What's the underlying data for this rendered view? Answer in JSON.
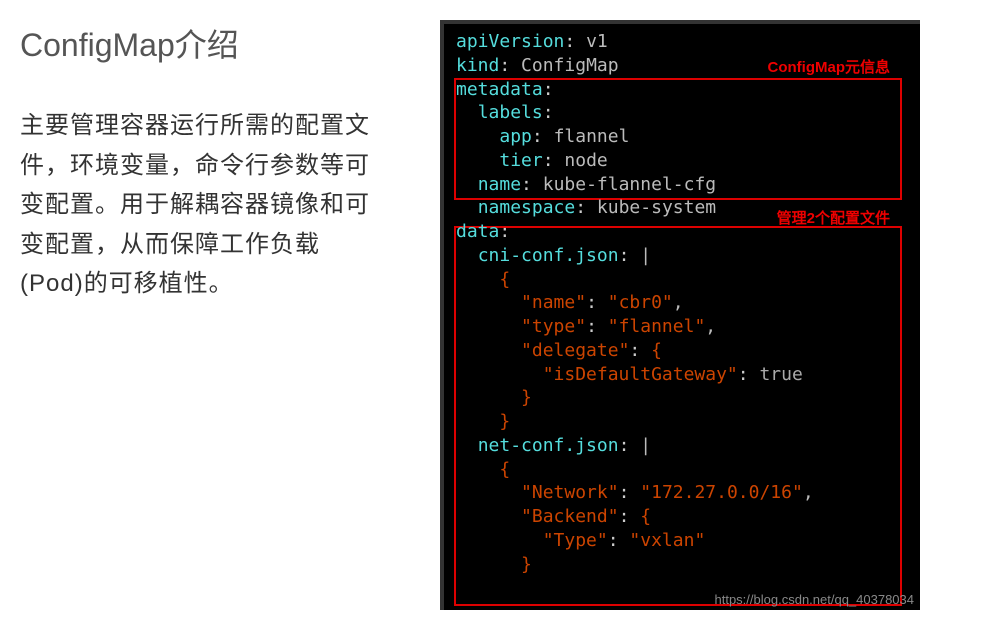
{
  "title": "ConfigMap介绍",
  "description": "主要管理容器运行所需的配置文件，环境变量，命令行参数等可变配置。用于解耦容器镜像和可变配置，从而保障工作负载(Pod)的可移植性。",
  "annotations": {
    "meta": "ConfigMap元信息",
    "files": "管理2个配置文件"
  },
  "yaml": {
    "apiVersion_key": "apiVersion",
    "apiVersion_val": "v1",
    "kind_key": "kind",
    "kind_val": "ConfigMap",
    "metadata_key": "metadata",
    "labels_key": "labels",
    "app_key": "app",
    "app_val": "flannel",
    "tier_key": "tier",
    "tier_val": "node",
    "name_key": "name",
    "name_val": "kube-flannel-cfg",
    "namespace_key": "namespace",
    "namespace_val": "kube-system",
    "data_key": "data",
    "cni_key": "cni-conf.json",
    "cni_name_k": "\"name\"",
    "cni_name_v": "\"cbr0\"",
    "cni_type_k": "\"type\"",
    "cni_type_v": "\"flannel\"",
    "cni_delegate_k": "\"delegate\"",
    "cni_gw_k": "\"isDefaultGateway\"",
    "cni_gw_v": "true",
    "net_key": "net-conf.json",
    "net_network_k": "\"Network\"",
    "net_network_v": "\"172.27.0.0/16\"",
    "net_backend_k": "\"Backend\"",
    "net_type_k": "\"Type\"",
    "net_type_v": "\"vxlan\""
  },
  "watermark": "https://blog.csdn.net/qq_40378034"
}
